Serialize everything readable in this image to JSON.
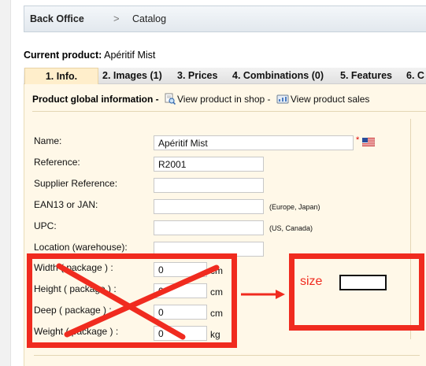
{
  "breadcrumb": {
    "home": "Back Office",
    "separator": ">",
    "current": "Catalog"
  },
  "current_product": {
    "label": "Current product:",
    "name": "Apéritif Mist"
  },
  "tabs": [
    "1. Info.",
    "2. Images (1)",
    "3. Prices",
    "4. Combinations (0)",
    "5. Features",
    "6. C"
  ],
  "panel": {
    "title": "Product global information -",
    "view_in_shop": "View product in shop -",
    "view_sales": "View product sales"
  },
  "form": {
    "name": {
      "label": "Name:",
      "value": "Apéritif Mist",
      "required_mark": "*"
    },
    "reference": {
      "label": "Reference:",
      "value": "R2001"
    },
    "supplier_reference": {
      "label": "Supplier Reference:",
      "value": ""
    },
    "ean13": {
      "label": "EAN13 or JAN:",
      "value": "",
      "hint": "(Europe, Japan)"
    },
    "upc": {
      "label": "UPC:",
      "value": "",
      "hint": "(US, Canada)"
    },
    "location": {
      "label": "Location (warehouse):",
      "value": ""
    },
    "width": {
      "label": "Width ( package ) :",
      "value": "0",
      "unit": "cm"
    },
    "height": {
      "label": "Height ( package ) :",
      "value": "0",
      "unit": "cm"
    },
    "deep": {
      "label": "Deep ( package ) :",
      "value": "0",
      "unit": "cm"
    },
    "weight": {
      "label": "Weight ( package ) :",
      "value": "0",
      "unit": "kg"
    }
  },
  "annotation": {
    "size_label": "size",
    "color": "#f02b1f"
  },
  "icons": {
    "view_in_shop": "magnifier-page-icon",
    "view_sales": "sales-report-icon",
    "language_flag": "us-flag-icon",
    "breadcrumb_separator": "chevron-right-icon"
  }
}
